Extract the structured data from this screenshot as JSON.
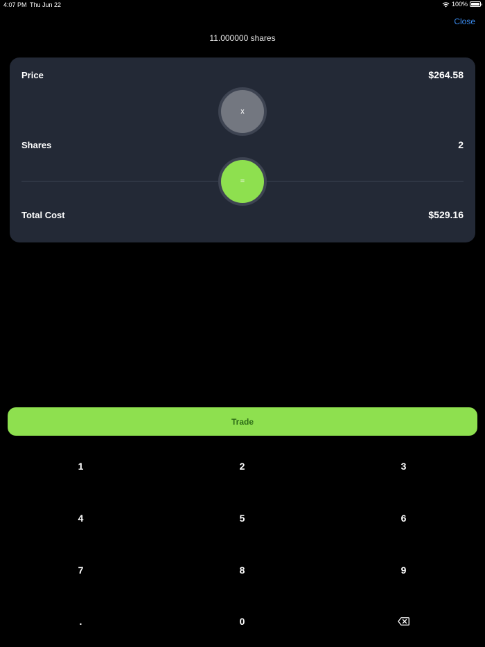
{
  "status_bar": {
    "time": "4:07 PM",
    "date": "Thu Jun 22",
    "battery": "100%"
  },
  "header": {
    "close_label": "Close",
    "shares_summary": "11.000000 shares"
  },
  "card": {
    "price_label": "Price",
    "price_value": "$264.58",
    "multiply_symbol": "x",
    "shares_label": "Shares",
    "shares_value": "2",
    "equals_symbol": "=",
    "total_label": "Total Cost",
    "total_value": "$529.16"
  },
  "trade_label": "Trade",
  "keypad": {
    "keys": [
      "1",
      "2",
      "3",
      "4",
      "5",
      "6",
      "7",
      "8",
      "9",
      ".",
      "0"
    ],
    "backspace_icon": "backspace-icon"
  },
  "colors": {
    "accent_green": "#8ee04f",
    "link_blue": "#3b8cf0",
    "card_bg": "#232936"
  }
}
